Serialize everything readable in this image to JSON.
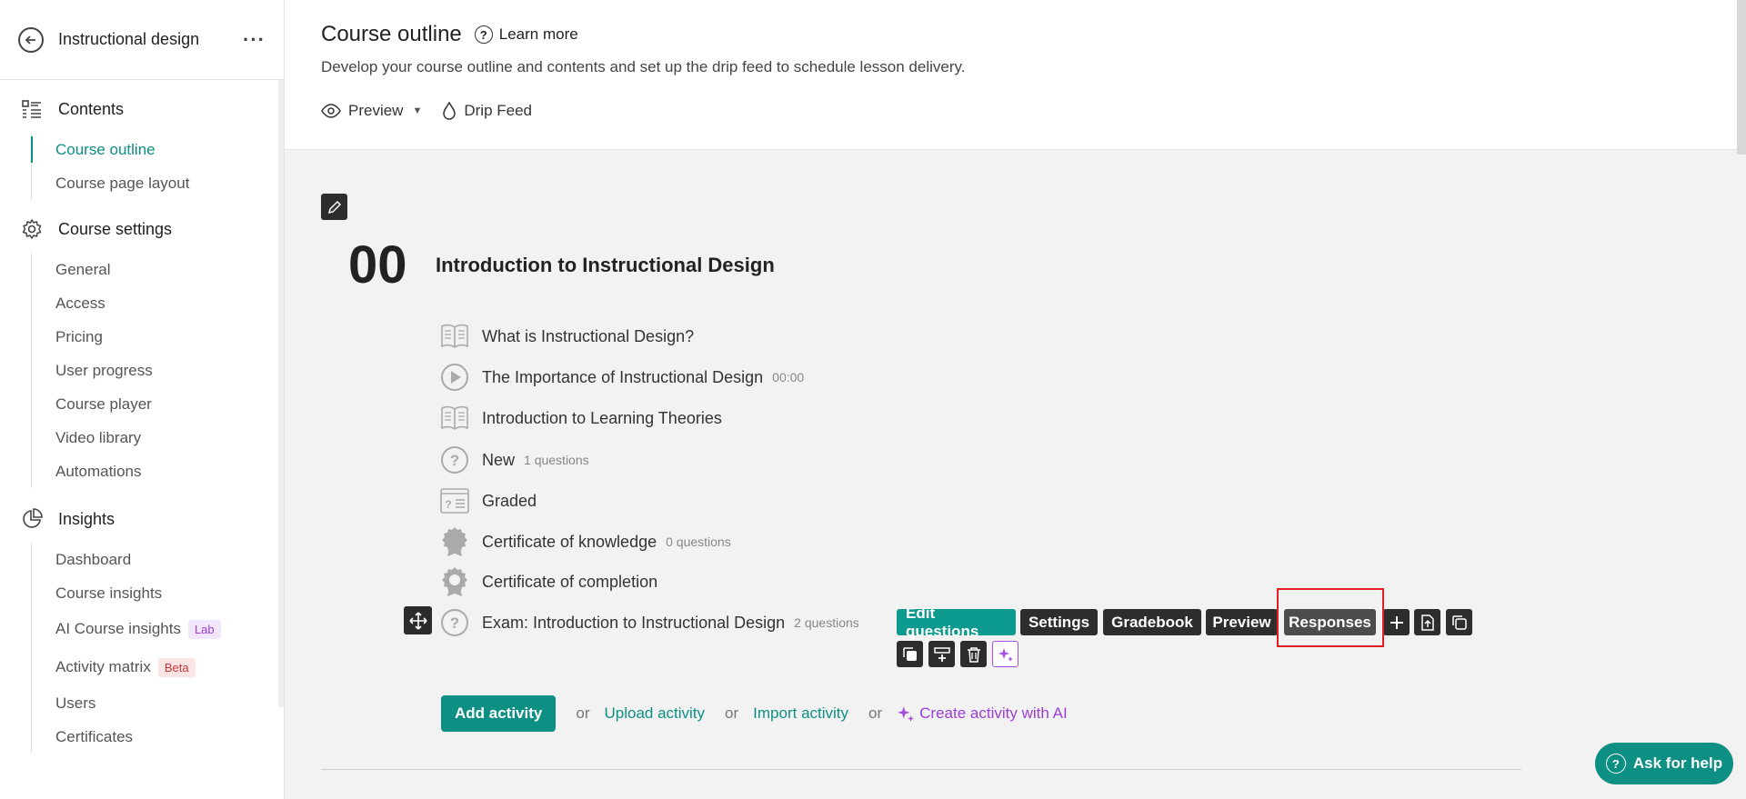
{
  "sidebar": {
    "title": "Instructional design",
    "more": "···",
    "contents_label": "Contents",
    "contents_items": [
      {
        "label": "Course outline",
        "active": true
      },
      {
        "label": "Course page layout",
        "active": false
      }
    ],
    "settings_label": "Course settings",
    "settings_items": [
      "General",
      "Access",
      "Pricing",
      "User progress",
      "Course player",
      "Video library",
      "Automations"
    ],
    "insights_label": "Insights",
    "insights_items": [
      {
        "label": "Dashboard"
      },
      {
        "label": "Course insights"
      },
      {
        "label": "AI Course insights",
        "tag": "Lab"
      },
      {
        "label": "Activity matrix",
        "tag": "Beta"
      },
      {
        "label": "Users"
      },
      {
        "label": "Certificates"
      }
    ]
  },
  "header": {
    "title": "Course outline",
    "learn_more": "Learn more",
    "subtitle": "Develop your course outline and contents and set up the drip feed to schedule lesson delivery.",
    "preview": "Preview",
    "drip_feed": "Drip Feed"
  },
  "chapter": {
    "number": "00",
    "title": "Introduction to Instructional Design",
    "lessons": [
      {
        "title": "What is Instructional Design?",
        "icon": "book-icon",
        "meta": ""
      },
      {
        "title": "The Importance of Instructional Design",
        "icon": "play-icon",
        "meta": "00:00"
      },
      {
        "title": "Introduction to Learning Theories",
        "icon": "book-icon",
        "meta": ""
      },
      {
        "title": "New",
        "icon": "question-icon",
        "meta": "1 questions"
      },
      {
        "title": "Graded",
        "icon": "graded-icon",
        "meta": ""
      },
      {
        "title": "Certificate of knowledge",
        "icon": "badge-icon",
        "meta": "0 questions"
      },
      {
        "title": "Certificate of completion",
        "icon": "award-icon",
        "meta": ""
      },
      {
        "title": "Exam: Introduction to Instructional Design",
        "icon": "question-icon",
        "meta": "2 questions"
      }
    ]
  },
  "toolbar": {
    "edit_questions": "Edit questions",
    "settings": "Settings",
    "gradebook": "Gradebook",
    "preview": "Preview",
    "responses": "Responses"
  },
  "add": {
    "add_activity": "Add activity",
    "or": "or",
    "upload": "Upload activity",
    "import": "Import activity",
    "ai": "Create activity with AI"
  },
  "help": {
    "label": "Ask for help"
  },
  "colors": {
    "accent": "#0e8f83",
    "ai": "#9b3fd4",
    "highlight": "#e0201f"
  }
}
